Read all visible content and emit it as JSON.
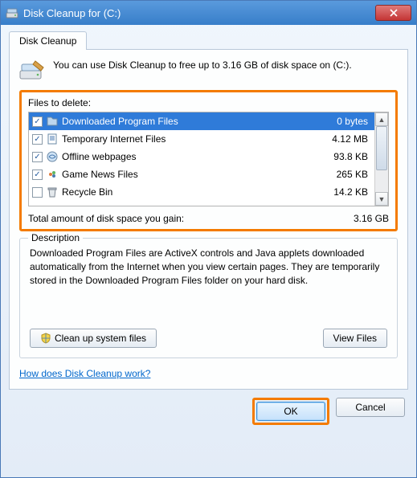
{
  "window": {
    "title": "Disk Cleanup for  (C:)"
  },
  "tab": {
    "label": "Disk Cleanup"
  },
  "intro": "You can use Disk Cleanup to free up to 3.16 GB of disk space on  (C:).",
  "files_label": "Files to delete:",
  "rows": [
    {
      "label": "Downloaded Program Files",
      "size": "0 bytes",
      "checked": true,
      "selected": true
    },
    {
      "label": "Temporary Internet Files",
      "size": "4.12 MB",
      "checked": true,
      "selected": false
    },
    {
      "label": "Offline webpages",
      "size": "93.8 KB",
      "checked": true,
      "selected": false
    },
    {
      "label": "Game News Files",
      "size": "265 KB",
      "checked": true,
      "selected": false
    },
    {
      "label": "Recycle Bin",
      "size": "14.2 KB",
      "checked": false,
      "selected": false
    }
  ],
  "total": {
    "label": "Total amount of disk space you gain:",
    "value": "3.16 GB"
  },
  "description": {
    "title": "Description",
    "text": "Downloaded Program Files are ActiveX controls and Java applets downloaded automatically from the Internet when you view certain pages. They are temporarily stored in the Downloaded Program Files folder on your hard disk."
  },
  "buttons": {
    "cleanup": "Clean up system files",
    "view": "View Files",
    "ok": "OK",
    "cancel": "Cancel"
  },
  "link": "How does Disk Cleanup work?"
}
